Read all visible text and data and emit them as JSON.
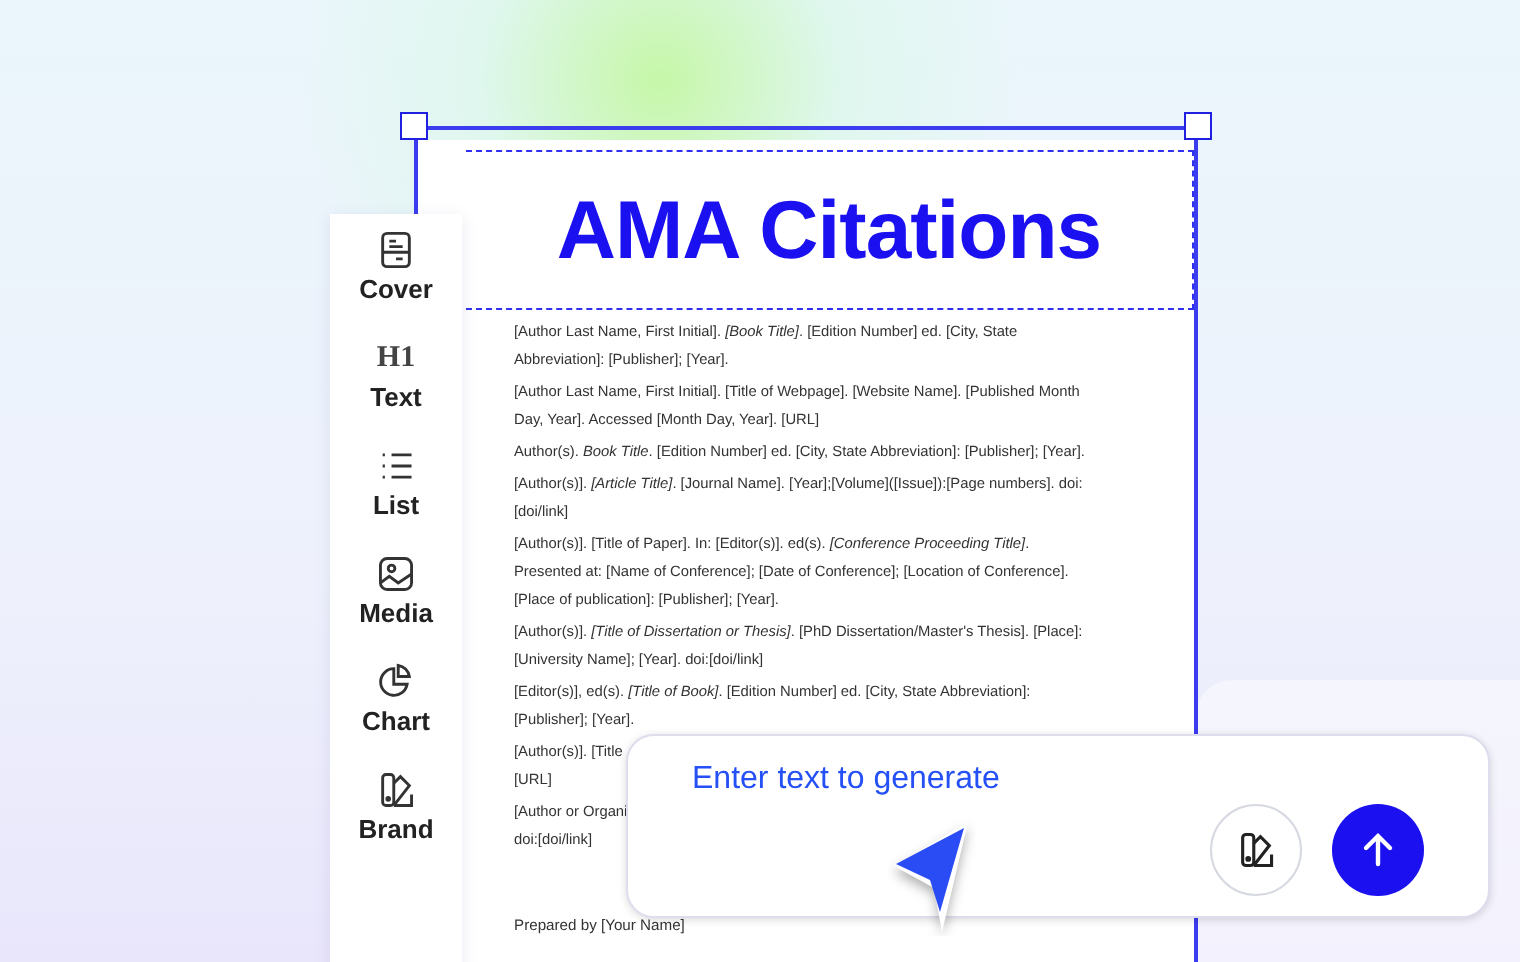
{
  "document": {
    "title": "AMA Citations",
    "citations": [
      {
        "lines": [
          "[Author Last Name, First Initial]. *[Book Title]*. [Edition Number] ed. [City, State",
          "Abbreviation]: [Publisher]; [Year]."
        ]
      },
      {
        "lines": [
          "[Author Last Name, First Initial]. [Title of Webpage]. [Website Name]. [Published Month",
          "Day, Year]. Accessed [Month Day, Year]. [URL]"
        ]
      },
      {
        "lines": [
          "Author(s). *Book Title*. [Edition Number] ed. [City, State Abbreviation]: [Publisher]; [Year]."
        ]
      },
      {
        "lines": [
          "[Author(s)]. *[Article Title]*. [Journal Name]. [Year];[Volume]([Issue]):[Page numbers]. doi:",
          "[doi/link]"
        ]
      },
      {
        "lines": [
          "[Author(s)]. [Title of Paper]. In: [Editor(s)]. ed(s). *[Conference Proceeding Title]*.",
          "Presented at: [Name of Conference]; [Date of Conference]; [Location of Conference].",
          "[Place of publication]: [Publisher]; [Year]."
        ]
      },
      {
        "lines": [
          "[Author(s)]. *[Title of Dissertation or Thesis]*. [PhD Dissertation/Master's Thesis]. [Place]:",
          "[University Name]; [Year]. doi:[doi/link]"
        ]
      },
      {
        "lines": [
          "[Editor(s)], ed(s). *[Title of Book]*. [Edition Number] ed. [City, State Abbreviation]:",
          "[Publisher]; [Year]."
        ]
      },
      {
        "lines": [
          "[Author(s)]. [Title",
          "[URL]"
        ]
      },
      {
        "lines": [
          "[Author or Organi",
          "doi:[doi/link]"
        ]
      }
    ],
    "footer": "Prepared by [Your Name]"
  },
  "toolbar": [
    {
      "label": "Cover",
      "kind": "cover"
    },
    {
      "label": "Text",
      "kind": "heading",
      "icon_text": "H1"
    },
    {
      "label": "List",
      "kind": "list"
    },
    {
      "label": "Media",
      "kind": "media"
    },
    {
      "label": "Chart",
      "kind": "chart"
    },
    {
      "label": "Brand",
      "kind": "brand"
    }
  ],
  "prompt": {
    "placeholder": "Enter text to generate"
  }
}
